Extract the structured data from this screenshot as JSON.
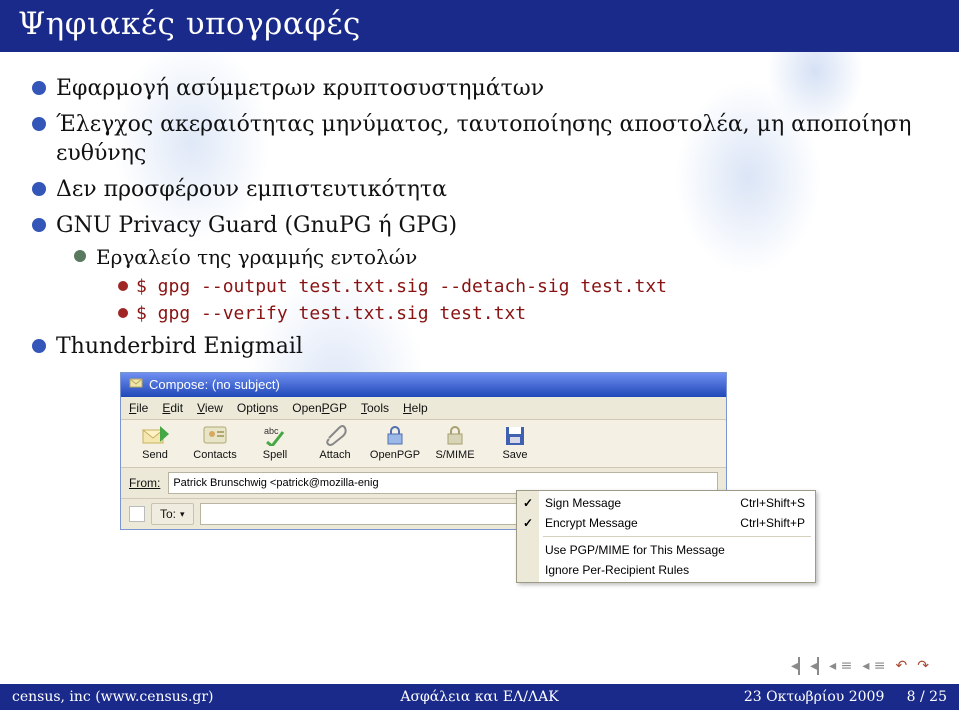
{
  "title": "Ψηφιακές υπογραφές",
  "bullets": {
    "b1": "Εφαρμογή ασύμμετρων κρυπτοσυστημάτων",
    "b2": "Έλεγχος ακεραιότητας μηνύματος, ταυτοποίησης αποστολέα, μη αποποίηση ευθύνης",
    "b3": "Δεν προσφέρουν εμπιστευτικότητα",
    "b4": "GNU Privacy Guard (GnuPG ή GPG)",
    "b4_1": "Εργαλείο της γραμμής εντολών",
    "b4_2": "$ gpg --output test.txt.sig --detach-sig test.txt",
    "b4_3": "$ gpg --verify test.txt.sig test.txt",
    "b5": "Thunderbird Enigmail"
  },
  "screenshot": {
    "window_title": "Compose: (no subject)",
    "menubar": {
      "file": "File",
      "edit": "Edit",
      "view": "View",
      "options": "Options",
      "openpgp": "OpenPGP",
      "tools": "Tools",
      "help": "Help"
    },
    "toolbar": {
      "send": "Send",
      "contacts": "Contacts",
      "spell": "Spell",
      "attach": "Attach",
      "openpgp": "OpenPGP",
      "smime": "S/MIME",
      "save": "Save"
    },
    "from_label": "From:",
    "from_value": "Patrick Brunschwig <patrick@mozilla-enig",
    "to_label": "To:",
    "contextmenu": {
      "sign": "Sign Message",
      "sign_accel": "Ctrl+Shift+S",
      "encrypt": "Encrypt Message",
      "encrypt_accel": "Ctrl+Shift+P",
      "usepgp": "Use PGP/MIME for This Message",
      "ignore": "Ignore Per-Recipient Rules"
    }
  },
  "footer": {
    "left": "census, inc (www.census.gr)",
    "center": "Ασφάλεια και ΕΛ/ΛΑΚ",
    "right_date": "23 Οκτωβρίου 2009",
    "right_page": "8 / 25"
  }
}
